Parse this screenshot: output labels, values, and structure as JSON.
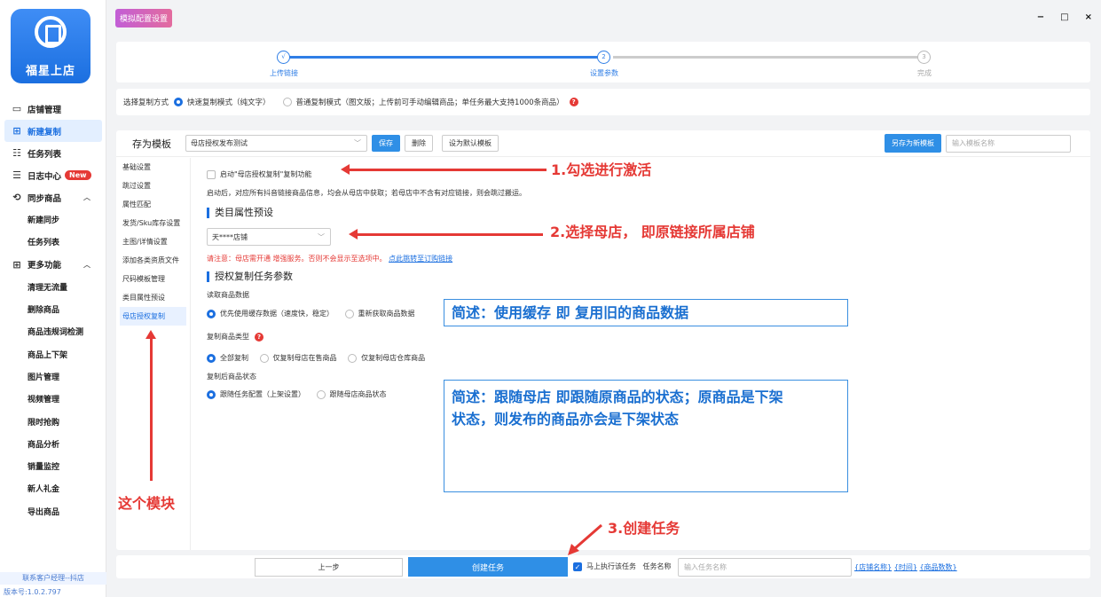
{
  "app": {
    "name": "福星上店",
    "title_tab": "模拟配置设置",
    "win_min": "−",
    "win_max": "□",
    "win_close": "×"
  },
  "sidebar": {
    "items": [
      {
        "label": "店铺管理",
        "icon": "store-icon"
      },
      {
        "label": "新建复制",
        "icon": "new-copy-icon",
        "active": true
      },
      {
        "label": "任务列表",
        "icon": "task-list-icon"
      },
      {
        "label": "日志中心",
        "icon": "log-icon",
        "badge": "New"
      },
      {
        "label": "同步商品",
        "icon": "sync-icon",
        "expanded": true
      }
    ],
    "sync_sub": [
      "新建同步",
      "任务列表"
    ],
    "more": {
      "label": "更多功能",
      "icon": "grid-icon"
    },
    "more_sub": [
      "清理无流量",
      "删除商品",
      "商品违规词检测",
      "商品上下架",
      "图片管理",
      "视频管理",
      "限时抢购",
      "商品分析",
      "销量监控",
      "新人礼金",
      "导出商品"
    ],
    "contact": "联系客户经理--抖店",
    "version": "版本号:1.0.2.797"
  },
  "steps": [
    {
      "num": "√",
      "label": "上传链接",
      "state": "done"
    },
    {
      "num": "2",
      "label": "设置参数",
      "state": "current"
    },
    {
      "num": "3",
      "label": "完成",
      "state": "pending"
    }
  ],
  "mode": {
    "label": "选择复制方式",
    "option1": "快速复制模式（纯文字）",
    "option2": "普通复制模式（图文版；上传前可手动编辑商品；单任务最大支持1000条商品）",
    "help": "?"
  },
  "template": {
    "label": "存为模板",
    "selected": "母店授权发布测试",
    "save": "保存",
    "delete": "删除",
    "set_default": "设为默认模板",
    "save_new": "另存为新模板",
    "name_placeholder": "输入模板名称"
  },
  "subnav": [
    "基础设置",
    "跳过设置",
    "属性匹配",
    "发货/Sku库存设置",
    "主图/详情设置",
    "添加各类资质文件",
    "尺码模板管理",
    "类目属性预设",
    "母店授权复制"
  ],
  "content": {
    "enable_label": "启动\"母店授权复制\"复制功能",
    "enable_desc": "启动后，对应所有抖音链接商品信息，均会从母店中获取；若母店中不含有对应链接，则会跳过搬运。",
    "cat_title": "类目属性预设",
    "store_selected": "天****店铺",
    "note_red": "请注意：母店需开通 增强服务。否则不会显示至选项中。",
    "note_link": "点此跳转至订购链接",
    "auth_title": "授权复制任务参数",
    "read_label": "读取商品数据",
    "read_opt1": "优先使用缓存数据（速度快，稳定）",
    "read_opt2": "重新获取商品数据",
    "type_label": "复制商品类型",
    "type_opt1": "全部复制",
    "type_opt2": "仅复制母店在售商品",
    "type_opt3": "仅复制母店仓库商品",
    "state_label": "复制后商品状态",
    "state_opt1": "跟随任务配置（上架设置）",
    "state_opt2": "跟随母店商品状态"
  },
  "annotations": {
    "a1": "1.勾选进行激活",
    "a2": "2.选择母店， 即原链接所属店铺",
    "a3": "3.创建任务",
    "module": "这个模块",
    "box1": "简述：使用缓存 即 复用旧的商品数据",
    "box2_line1": "简述：跟随母店 即跟随原商品的状态；原商品是下架",
    "box2_line2": "状态，则发布的商品亦会是下架状态"
  },
  "bottom": {
    "prev": "上一步",
    "create": "创建任务",
    "exec_now": "马上执行该任务",
    "task_name_label": "任务名称",
    "task_name_placeholder": "输入任务名称",
    "tag1": "{店铺名称}",
    "tag2": "{时间}",
    "tag3": "{商品数数}"
  }
}
